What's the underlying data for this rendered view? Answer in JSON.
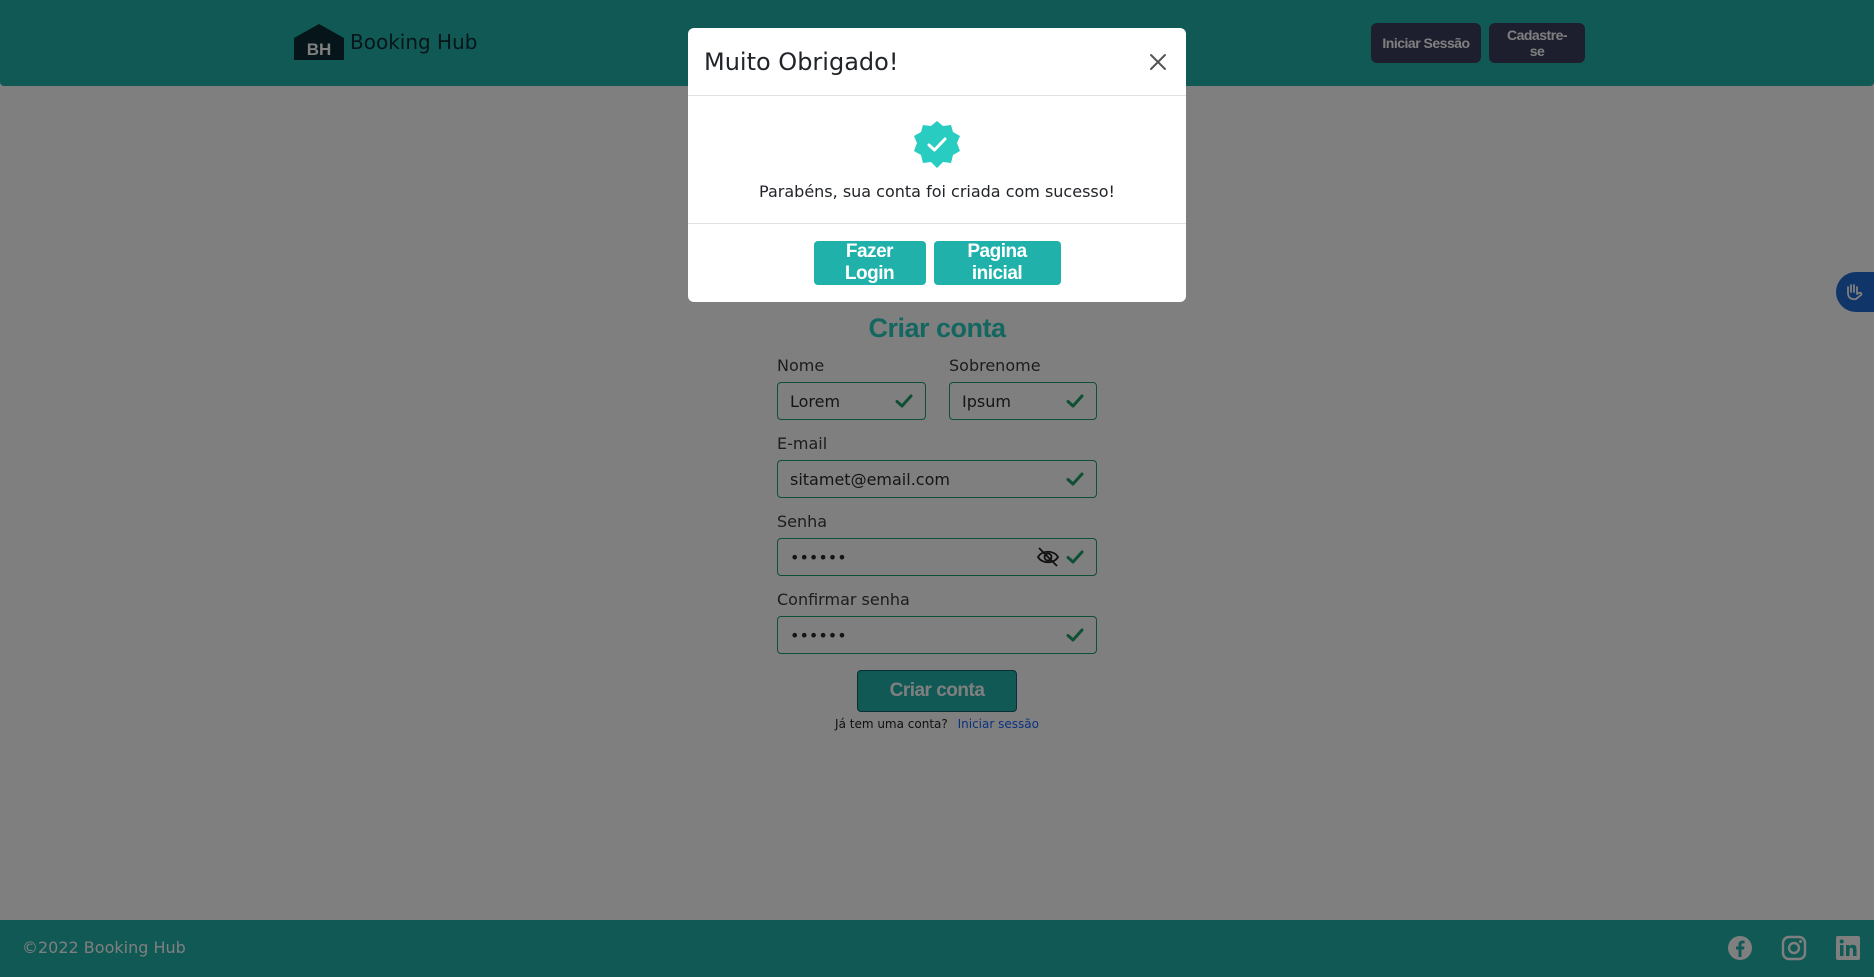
{
  "header": {
    "logo_letters": "BH",
    "brand": "Booking Hub",
    "login_label": "Iniciar Sessão",
    "signup_label": "Cadastre-se"
  },
  "form": {
    "title": "Criar conta",
    "first_name": {
      "label": "Nome",
      "value": "Lorem"
    },
    "last_name": {
      "label": "Sobrenome",
      "value": "Ipsum"
    },
    "email": {
      "label": "E-mail",
      "value": "sitamet@email.com"
    },
    "password": {
      "label": "Senha",
      "value": "••••••"
    },
    "confirm_password": {
      "label": "Confirmar senha",
      "value": "••••••"
    },
    "submit_label": "Criar conta",
    "have_account_text": "Já tem uma conta?",
    "login_link": "Iniciar sessão"
  },
  "modal": {
    "title": "Muito Obrigado!",
    "message": "Parabéns, sua conta foi criada com sucesso!",
    "login_button": "Fazer Login",
    "home_button": "Pagina inicial"
  },
  "footer": {
    "copyright": "©2022 Booking Hub",
    "socials": [
      "facebook-icon",
      "instagram-icon",
      "linkedin-icon"
    ]
  },
  "colors": {
    "accent": "#20b2aa",
    "dark_button": "#3b3e5f",
    "valid_green": "#1f9f67",
    "link": "#1764ff"
  }
}
